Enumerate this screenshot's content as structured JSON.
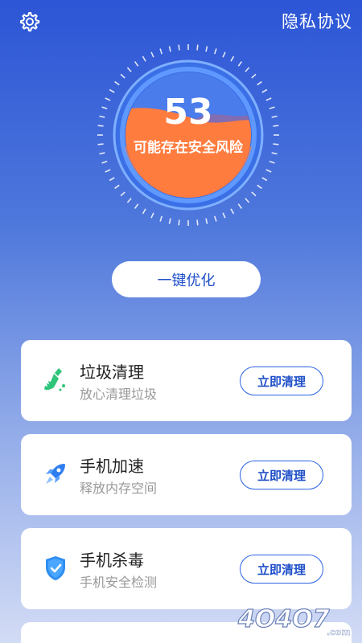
{
  "header": {
    "privacy_label": "隐私协议",
    "settings_icon": "gear-icon"
  },
  "gauge": {
    "score": "53",
    "status": "可能存在安全风险",
    "wave_color": "#ff7c3f",
    "ring_color": "#6fa3ff"
  },
  "optimize_button": "一键优化",
  "features": [
    {
      "title": "垃圾清理",
      "subtitle": "放心清理垃圾",
      "action": "立即清理",
      "icon": "broom-icon",
      "icon_color": "#2fc57a"
    },
    {
      "title": "手机加速",
      "subtitle": "释放内存空间",
      "action": "立即清理",
      "icon": "rocket-icon",
      "icon_color": "#2f7ef0"
    },
    {
      "title": "手机杀毒",
      "subtitle": "手机安全检测",
      "action": "立即清理",
      "icon": "shield-check-icon",
      "icon_color": "#2f8ef0"
    }
  ],
  "colors": {
    "accent": "#1f4fc8",
    "bg_top": "#2c55d6",
    "bg_bottom": "#d3dcf5"
  },
  "watermark": "4O4O7.com"
}
